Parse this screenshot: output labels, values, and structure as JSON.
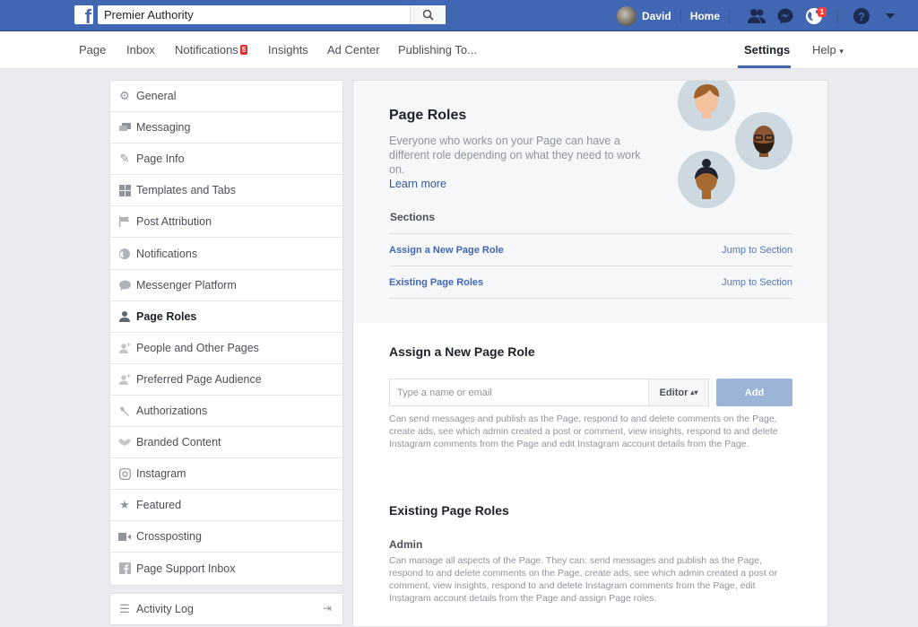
{
  "topbar": {
    "search_value": "Premier Authority",
    "user_name": "David",
    "home_label": "Home",
    "notifications_badge": "1",
    "brand_color": "#4267b2"
  },
  "subnav": {
    "items": [
      {
        "label": "Page"
      },
      {
        "label": "Inbox"
      },
      {
        "label": "Notifications",
        "badge": "5"
      },
      {
        "label": "Insights"
      },
      {
        "label": "Ad Center"
      },
      {
        "label": "Publishing To..."
      }
    ],
    "settings_label": "Settings",
    "help_label": "Help",
    "help_caret": "▾"
  },
  "sidebar": {
    "items": [
      {
        "label": "General",
        "icon": "gear-icon"
      },
      {
        "label": "Messaging",
        "icon": "messaging-icon"
      },
      {
        "label": "Page Info",
        "icon": "pencil-icon"
      },
      {
        "label": "Templates and Tabs",
        "icon": "grid-icon"
      },
      {
        "label": "Post Attribution",
        "icon": "flag-icon"
      },
      {
        "label": "Notifications",
        "icon": "globe-icon"
      },
      {
        "label": "Messenger Platform",
        "icon": "chat-bubble-icon"
      },
      {
        "label": "Page Roles",
        "icon": "person-icon",
        "active": true
      },
      {
        "label": "People and Other Pages",
        "icon": "person-plus-icon"
      },
      {
        "label": "Preferred Page Audience",
        "icon": "person-plus-icon"
      },
      {
        "label": "Authorizations",
        "icon": "wrench-icon"
      },
      {
        "label": "Branded Content",
        "icon": "handshake-icon"
      },
      {
        "label": "Instagram",
        "icon": "instagram-icon"
      },
      {
        "label": "Featured",
        "icon": "star-icon"
      },
      {
        "label": "Crossposting",
        "icon": "video-camera-icon"
      },
      {
        "label": "Page Support Inbox",
        "icon": "facebook-icon"
      }
    ],
    "activity_log_label": "Activity Log"
  },
  "main": {
    "title": "Page Roles",
    "description": "Everyone who works on your Page can have a different role depending on what they need to work on.",
    "learn_more": "Learn more",
    "sections_label": "Sections",
    "sections": [
      {
        "label": "Assign a New Page Role",
        "jump": "Jump to Section"
      },
      {
        "label": "Existing Page Roles",
        "jump": "Jump to Section"
      }
    ],
    "assign": {
      "title": "Assign a New Page Role",
      "input_placeholder": "Type a name or email",
      "input_value": "",
      "role_selected": "Editor",
      "add_label": "Add",
      "description": "Can send messages and publish as the Page, respond to and delete comments on the Page, create ads, see which admin created a post or comment, view insights, respond to and delete Instagram comments from the Page and edit Instagram account details from the Page."
    },
    "existing": {
      "title": "Existing Page Roles",
      "admin_label": "Admin",
      "admin_description": "Can manage all aspects of the Page. They can: send messages and publish as the Page, respond to and delete comments on the Page, create ads, see which admin created a post or comment, view insights, respond to and delete Instagram comments from the Page, edit Instagram account details from the Page and assign Page roles."
    }
  }
}
